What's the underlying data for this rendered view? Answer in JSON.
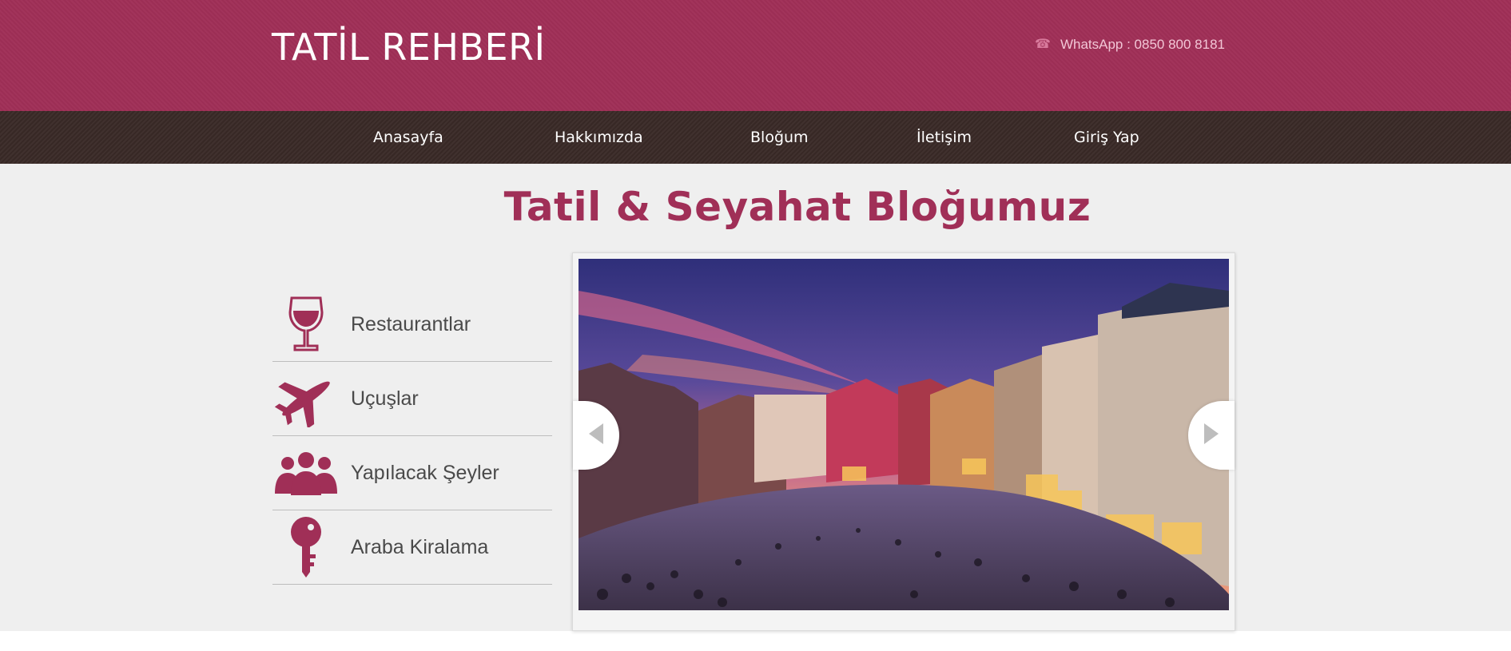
{
  "header": {
    "brand": "TATİL REHBERİ",
    "contact_icon": "phone-icon",
    "contact_text": "WhatsApp : 0850 800 8181",
    "color": "#a02f57"
  },
  "nav": {
    "items": [
      {
        "label": "Anasayfa"
      },
      {
        "label": "Hakkımızda"
      },
      {
        "label": "Bloğum"
      },
      {
        "label": "İletişim"
      },
      {
        "label": "Giriş Yap"
      }
    ],
    "color": "#3a2a27"
  },
  "main": {
    "title": "Tatil & Seyahat Bloğumuz",
    "accent": "#a02f57"
  },
  "sidebar": {
    "items": [
      {
        "label": "Restaurantlar",
        "icon": "wine-glass-icon"
      },
      {
        "label": "Uçuşlar",
        "icon": "airplane-icon"
      },
      {
        "label": "Yapılacak Şeyler",
        "icon": "people-icon"
      },
      {
        "label": "Araba Kiralama",
        "icon": "key-icon"
      }
    ]
  },
  "slider": {
    "image": "town-square-at-dusk-photo",
    "prev_icon": "arrow-left-icon",
    "next_icon": "arrow-right-icon"
  }
}
